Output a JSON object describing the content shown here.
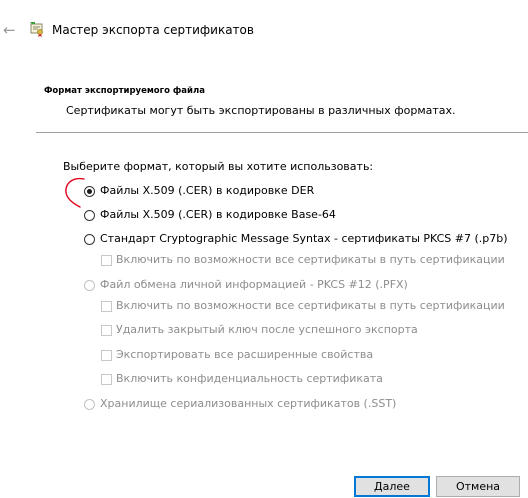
{
  "window": {
    "title": "Мастер экспорта сертификатов"
  },
  "header": {
    "title": "Формат экспортируемого файла",
    "subtitle": "Сертификаты могут быть экспортированы в различных форматах."
  },
  "form": {
    "prompt": "Выберите формат, который вы хотите использовать:",
    "options": [
      {
        "label": "Файлы X.509 (.CER) в кодировке DER",
        "selected": true,
        "enabled": true
      },
      {
        "label": "Файлы X.509 (.CER) в кодировке Base-64",
        "selected": false,
        "enabled": true
      },
      {
        "label": "Стандарт Cryptographic Message Syntax - сертификаты PKCS #7 (.p7b)",
        "selected": false,
        "enabled": true
      },
      {
        "label": "Файл обмена личной информацией - PKCS #12 (.PFX)",
        "selected": false,
        "enabled": false
      },
      {
        "label": "Хранилище сериализованных сертификатов (.SST)",
        "selected": false,
        "enabled": false
      }
    ],
    "p7b_checks": [
      {
        "label": "Включить по возможности все сертификаты в путь сертификации",
        "checked": false,
        "enabled": false
      }
    ],
    "pfx_checks": [
      {
        "label": "Включить по возможности все сертификаты в путь сертификации",
        "checked": false,
        "enabled": false
      },
      {
        "label": "Удалить закрытый ключ после успешного экспорта",
        "checked": false,
        "enabled": false
      },
      {
        "label": "Экспортировать все расширенные свойства",
        "checked": false,
        "enabled": false
      },
      {
        "label": "Включить конфиденциальность сертификата",
        "checked": false,
        "enabled": false
      }
    ]
  },
  "buttons": {
    "next": "Далее",
    "cancel": "Отмена"
  },
  "colors": {
    "annotation": "#e0001a",
    "default_button_border": "#0078d7",
    "disabled_text": "#8d8d8d"
  }
}
